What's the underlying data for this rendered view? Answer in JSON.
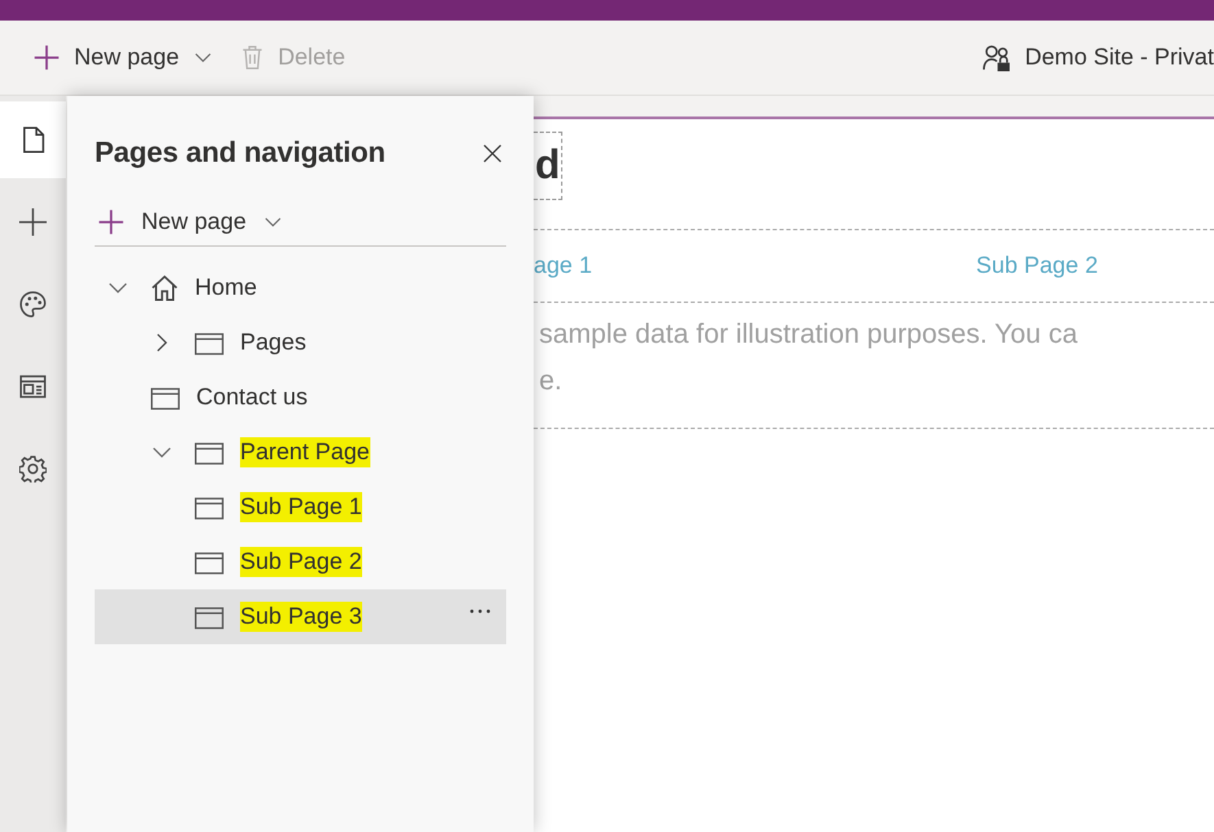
{
  "toolbar": {
    "new_page": {
      "label": "New page"
    },
    "delete": {
      "label": "Delete",
      "disabled": true
    },
    "site": {
      "label": "Demo Site - Privat"
    }
  },
  "rail": {
    "items": [
      {
        "kind": "page",
        "selected": true
      },
      {
        "kind": "add",
        "selected": false
      },
      {
        "kind": "palette",
        "selected": false
      },
      {
        "kind": "layout",
        "selected": false
      },
      {
        "kind": "settings",
        "selected": false
      }
    ]
  },
  "panel": {
    "title": "Pages and navigation",
    "new_page": "New page",
    "tree": [
      {
        "label": "Home",
        "kind": "home",
        "expanded": true,
        "highlighted": false,
        "selected": false,
        "children": [
          {
            "label": "Pages",
            "kind": "page",
            "expanded": false,
            "highlighted": false,
            "selected": false
          },
          {
            "label": "Contact us",
            "kind": "page",
            "highlighted": false,
            "selected": false
          },
          {
            "label": "Parent Page",
            "kind": "page",
            "expanded": true,
            "highlighted": true,
            "selected": false,
            "children": [
              {
                "label": "Sub Page 1",
                "kind": "page",
                "highlighted": true,
                "selected": false
              },
              {
                "label": "Sub Page 2",
                "kind": "page",
                "highlighted": true,
                "selected": false
              },
              {
                "label": "Sub Page 3",
                "kind": "page",
                "highlighted": true,
                "selected": true
              }
            ]
          }
        ]
      }
    ]
  },
  "canvas": {
    "title": "d",
    "links": [
      "age 1",
      "Sub Page 2"
    ],
    "paragraph_lines": [
      "sample data for illustration purposes. You ca",
      "e."
    ]
  }
}
